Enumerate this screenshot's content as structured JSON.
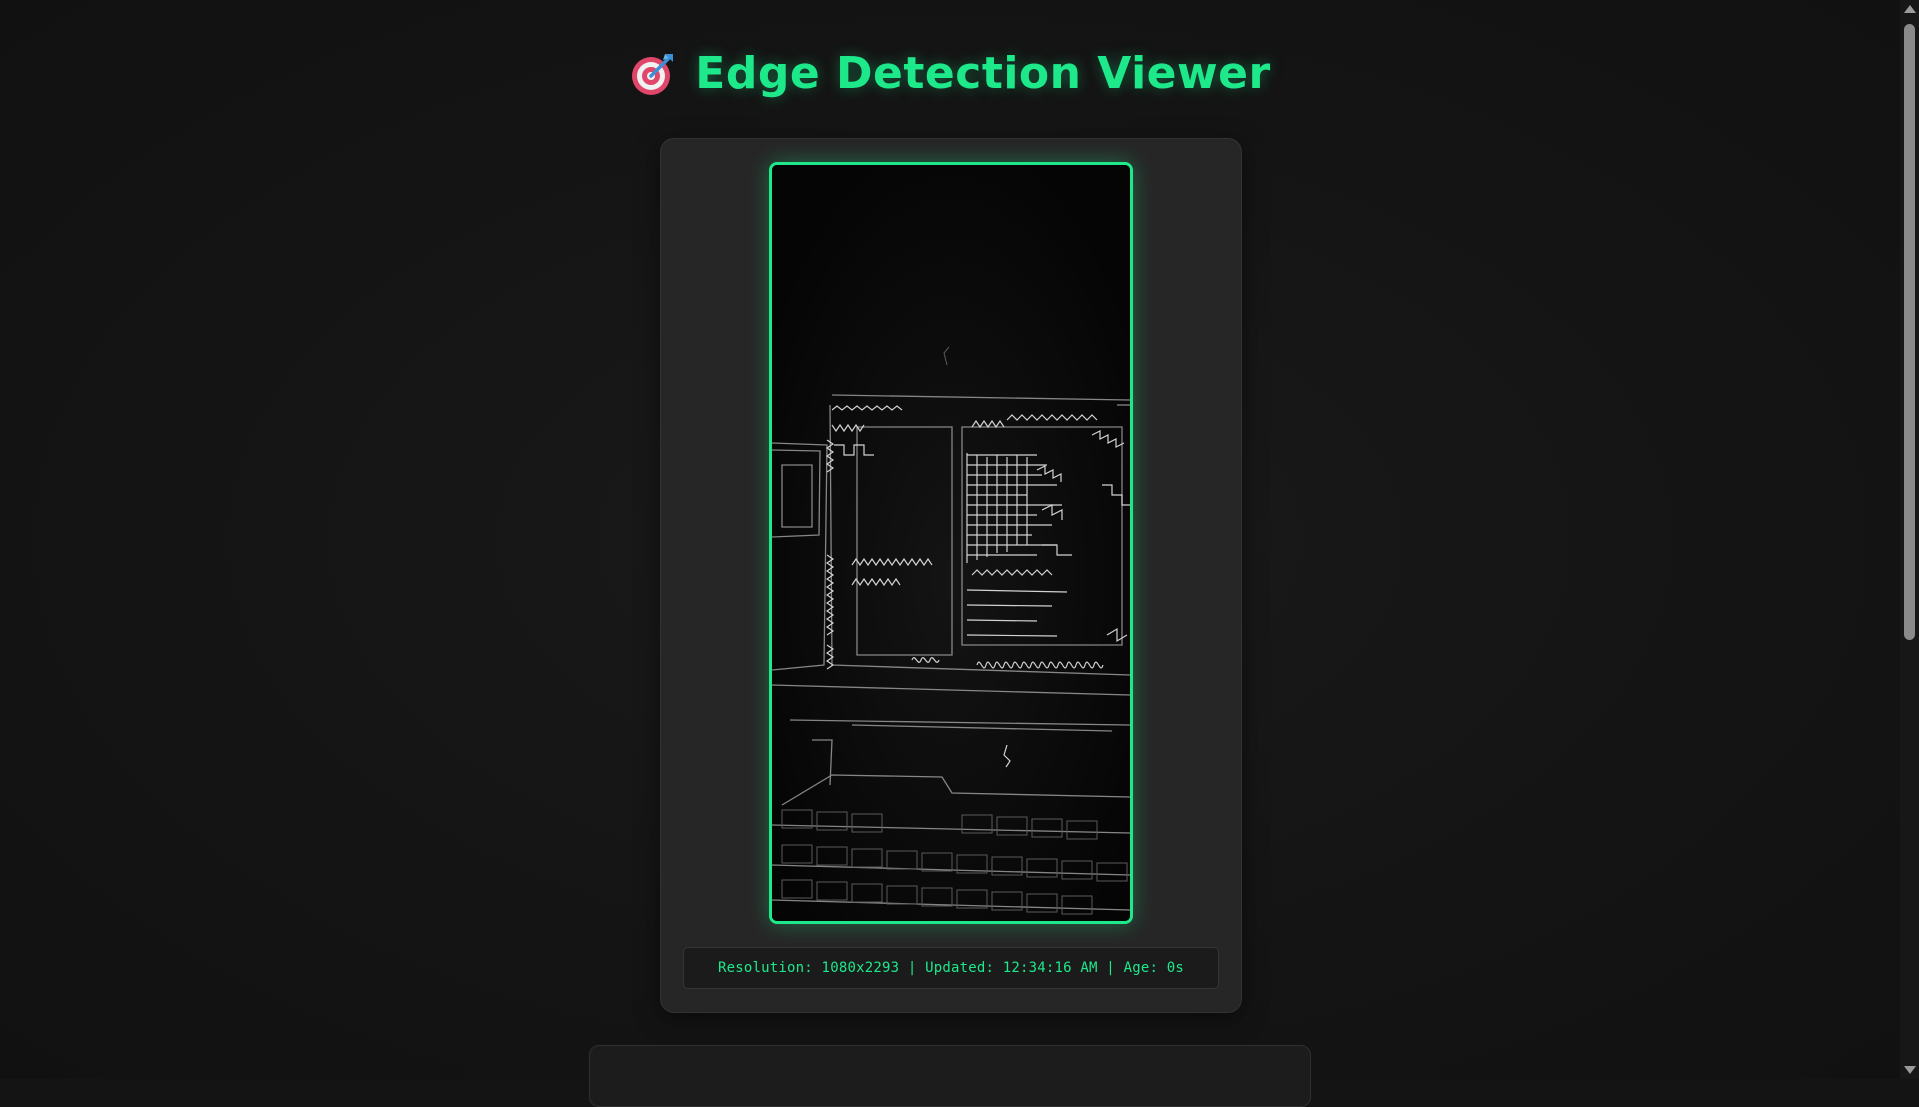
{
  "header": {
    "icon": "target-dart-icon",
    "title": "Edge Detection Viewer"
  },
  "viewer": {
    "image_alt": "edge-detected camera frame",
    "status_text": "Resolution: 1080x2293 | Updated: 12:34:16 AM | Age: 0s"
  },
  "colors": {
    "accent": "#1de98b",
    "background": "#141414",
    "card": "#262626"
  }
}
